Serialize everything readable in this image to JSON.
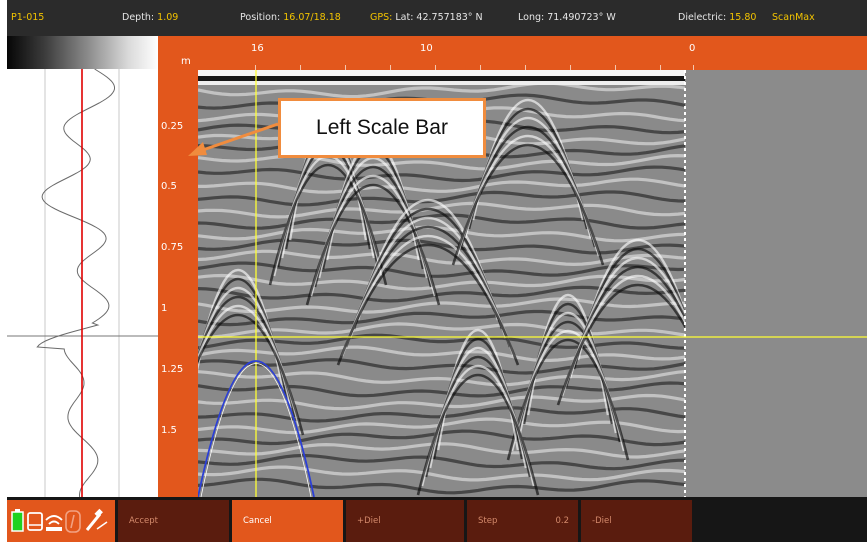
{
  "status_bar": {
    "file": "P1-015",
    "depth_label": "Depth:",
    "depth_value": "1.09",
    "position_label": "Position:",
    "position_value": "16.07/18.18",
    "gps_label": "GPS:",
    "gps_lat": "Lat: 42.757183° N",
    "gps_long": "Long: 71.490723° W",
    "dielectric_label": "Dielectric:",
    "dielectric_value": "15.80",
    "scan_mode": "ScanMax"
  },
  "top_ruler": {
    "unit": "m",
    "labels": [
      "16",
      "10",
      "0"
    ]
  },
  "left_scale": {
    "labels": [
      "0.25",
      "0.5",
      "0.75",
      "1",
      "1.25",
      "1.5"
    ]
  },
  "callout": {
    "text": "Left Scale Bar"
  },
  "softkeys": {
    "accept": "Accept",
    "cancel": "Cancel",
    "plus_diel": "+Diel",
    "step": "Step",
    "step_value": "0.2",
    "minus_diel": "-Diel"
  },
  "status_icons": [
    "battery-icon",
    "storage-icon",
    "wifi-icon",
    "info-icon",
    "satellite-icon"
  ],
  "colors": {
    "accent": "#e2571c",
    "status_value": "#f2c300",
    "cursor": "#ffff33",
    "hyperbola": "#2b3fd6",
    "trace_marker": "#e00000",
    "callout_border": "#f08c3e"
  }
}
